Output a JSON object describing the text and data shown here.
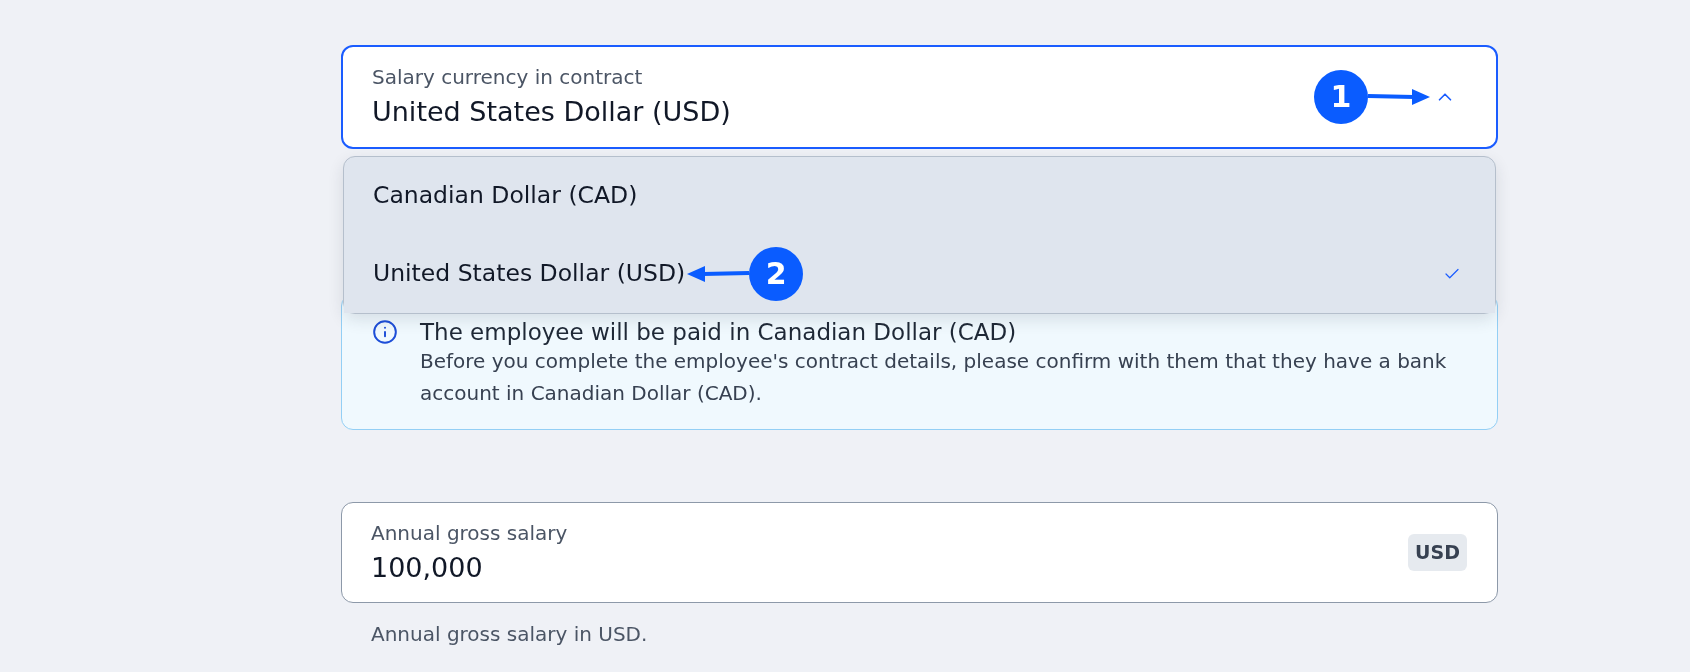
{
  "currency_select": {
    "label": "Salary currency in contract",
    "value": "United States Dollar (USD)",
    "expanded": true,
    "callout": "1",
    "options": [
      {
        "label": "Canadian Dollar (CAD)",
        "selected": false
      },
      {
        "label": "United States Dollar (USD)",
        "selected": true,
        "callout": "2"
      }
    ]
  },
  "info_notice": {
    "title": "The employee will be paid in Canadian Dollar (CAD)",
    "body": "Before you complete the employee's contract details, please confirm with them that they have a bank account in Canadian Dollar (CAD)."
  },
  "salary_field": {
    "label": "Annual gross salary",
    "value": "100,000",
    "unit": "USD",
    "helper": "Annual gross salary in USD."
  }
}
